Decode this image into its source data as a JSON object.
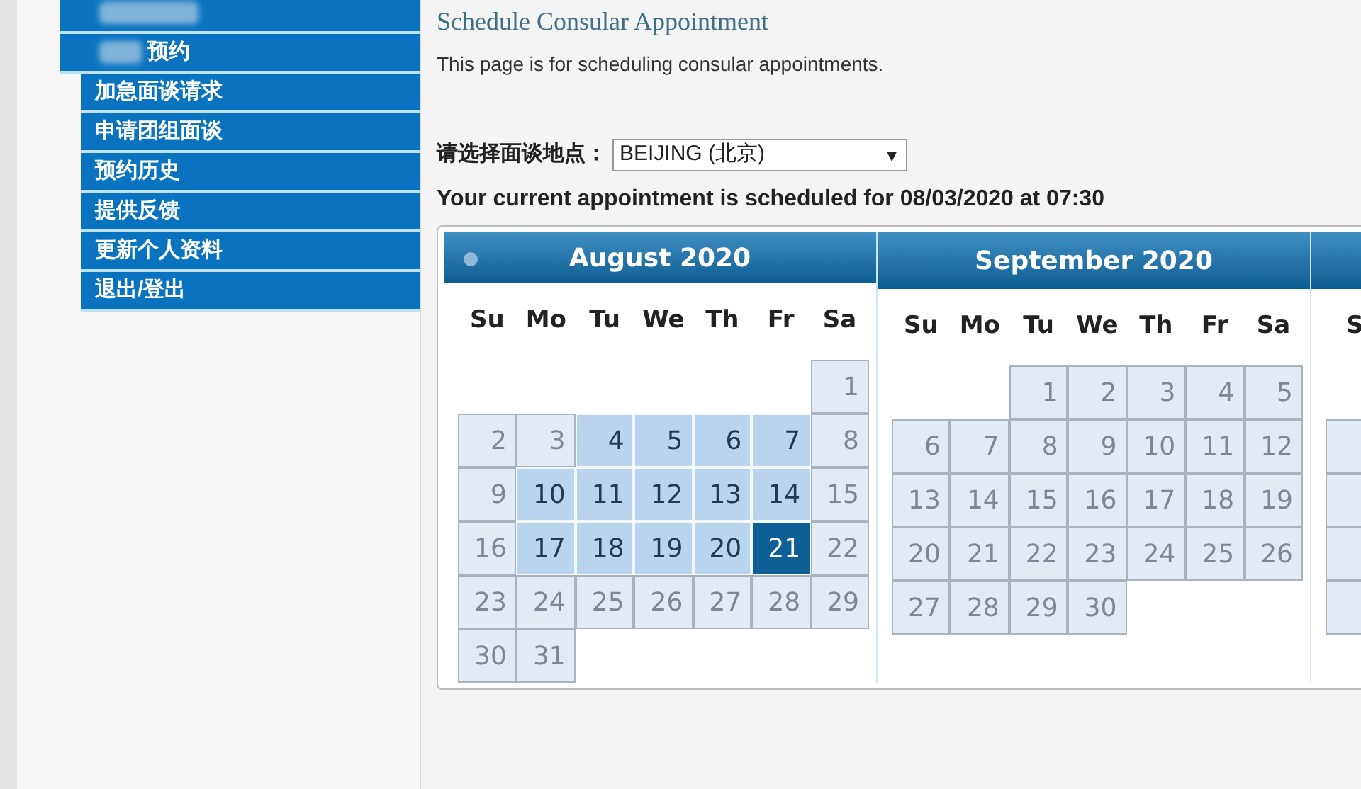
{
  "sidebar": {
    "items": [
      {
        "kind": "redacted"
      },
      {
        "kind": "partial",
        "label": "预约"
      },
      {
        "kind": "link",
        "label": "加急面谈请求"
      },
      {
        "kind": "link",
        "label": "申请团组面谈"
      },
      {
        "kind": "link",
        "label": "预约历史"
      },
      {
        "kind": "link",
        "label": "提供反馈"
      },
      {
        "kind": "link",
        "label": "更新个人资料"
      },
      {
        "kind": "link",
        "label": "退出/登出"
      }
    ]
  },
  "page": {
    "title": "Schedule Consular Appointment",
    "description": "This page is for scheduling consular appointments."
  },
  "location": {
    "label": "请选择面谈地点：",
    "value": "BEIJING (北京)",
    "caret": "▼"
  },
  "current_appointment": "Your current appointment is scheduled for 08/03/2020 at 07:30",
  "calendar": {
    "months": [
      {
        "title": "August 2020",
        "has_prev": true,
        "weekdays": [
          "Su",
          "Mo",
          "Tu",
          "We",
          "Th",
          "Fr",
          "Sa"
        ],
        "weeks": [
          [
            {
              "kind": "blank"
            },
            {
              "kind": "blank"
            },
            {
              "kind": "blank"
            },
            {
              "kind": "blank"
            },
            {
              "kind": "blank"
            },
            {
              "kind": "blank"
            },
            {
              "kind": "day",
              "label": "1",
              "available": false,
              "selected": false
            }
          ],
          [
            {
              "kind": "day",
              "label": "2",
              "available": false,
              "selected": false
            },
            {
              "kind": "day",
              "label": "3",
              "available": false,
              "selected": false
            },
            {
              "kind": "day",
              "label": "4",
              "available": true,
              "selected": false
            },
            {
              "kind": "day",
              "label": "5",
              "available": true,
              "selected": false
            },
            {
              "kind": "day",
              "label": "6",
              "available": true,
              "selected": false
            },
            {
              "kind": "day",
              "label": "7",
              "available": true,
              "selected": false
            },
            {
              "kind": "day",
              "label": "8",
              "available": false,
              "selected": false
            }
          ],
          [
            {
              "kind": "day",
              "label": "9",
              "available": false,
              "selected": false
            },
            {
              "kind": "day",
              "label": "10",
              "available": true,
              "selected": false
            },
            {
              "kind": "day",
              "label": "11",
              "available": true,
              "selected": false
            },
            {
              "kind": "day",
              "label": "12",
              "available": true,
              "selected": false
            },
            {
              "kind": "day",
              "label": "13",
              "available": true,
              "selected": false
            },
            {
              "kind": "day",
              "label": "14",
              "available": true,
              "selected": false
            },
            {
              "kind": "day",
              "label": "15",
              "available": false,
              "selected": false
            }
          ],
          [
            {
              "kind": "day",
              "label": "16",
              "available": false,
              "selected": false
            },
            {
              "kind": "day",
              "label": "17",
              "available": true,
              "selected": false
            },
            {
              "kind": "day",
              "label": "18",
              "available": true,
              "selected": false
            },
            {
              "kind": "day",
              "label": "19",
              "available": true,
              "selected": false
            },
            {
              "kind": "day",
              "label": "20",
              "available": true,
              "selected": false
            },
            {
              "kind": "day",
              "label": "21",
              "available": true,
              "selected": true
            },
            {
              "kind": "day",
              "label": "22",
              "available": false,
              "selected": false
            }
          ],
          [
            {
              "kind": "day",
              "label": "23",
              "available": false,
              "selected": false
            },
            {
              "kind": "day",
              "label": "24",
              "available": false,
              "selected": false
            },
            {
              "kind": "day",
              "label": "25",
              "available": false,
              "selected": false
            },
            {
              "kind": "day",
              "label": "26",
              "available": false,
              "selected": false
            },
            {
              "kind": "day",
              "label": "27",
              "available": false,
              "selected": false
            },
            {
              "kind": "day",
              "label": "28",
              "available": false,
              "selected": false
            },
            {
              "kind": "day",
              "label": "29",
              "available": false,
              "selected": false
            }
          ],
          [
            {
              "kind": "day",
              "label": "30",
              "available": false,
              "selected": false
            },
            {
              "kind": "day",
              "label": "31",
              "available": false,
              "selected": false
            }
          ]
        ]
      },
      {
        "title": "September 2020",
        "has_prev": false,
        "weekdays": [
          "Su",
          "Mo",
          "Tu",
          "We",
          "Th",
          "Fr",
          "Sa"
        ],
        "weeks": [
          [
            {
              "kind": "blank"
            },
            {
              "kind": "blank"
            },
            {
              "kind": "day",
              "label": "1",
              "available": false,
              "selected": false
            },
            {
              "kind": "day",
              "label": "2",
              "available": false,
              "selected": false
            },
            {
              "kind": "day",
              "label": "3",
              "available": false,
              "selected": false
            },
            {
              "kind": "day",
              "label": "4",
              "available": false,
              "selected": false
            },
            {
              "kind": "day",
              "label": "5",
              "available": false,
              "selected": false
            }
          ],
          [
            {
              "kind": "day",
              "label": "6",
              "available": false,
              "selected": false
            },
            {
              "kind": "day",
              "label": "7",
              "available": false,
              "selected": false
            },
            {
              "kind": "day",
              "label": "8",
              "available": false,
              "selected": false
            },
            {
              "kind": "day",
              "label": "9",
              "available": false,
              "selected": false
            },
            {
              "kind": "day",
              "label": "10",
              "available": false,
              "selected": false
            },
            {
              "kind": "day",
              "label": "11",
              "available": false,
              "selected": false
            },
            {
              "kind": "day",
              "label": "12",
              "available": false,
              "selected": false
            }
          ],
          [
            {
              "kind": "day",
              "label": "13",
              "available": false,
              "selected": false
            },
            {
              "kind": "day",
              "label": "14",
              "available": false,
              "selected": false
            },
            {
              "kind": "day",
              "label": "15",
              "available": false,
              "selected": false
            },
            {
              "kind": "day",
              "label": "16",
              "available": false,
              "selected": false
            },
            {
              "kind": "day",
              "label": "17",
              "available": false,
              "selected": false
            },
            {
              "kind": "day",
              "label": "18",
              "available": false,
              "selected": false
            },
            {
              "kind": "day",
              "label": "19",
              "available": false,
              "selected": false
            }
          ],
          [
            {
              "kind": "day",
              "label": "20",
              "available": false,
              "selected": false
            },
            {
              "kind": "day",
              "label": "21",
              "available": false,
              "selected": false
            },
            {
              "kind": "day",
              "label": "22",
              "available": false,
              "selected": false
            },
            {
              "kind": "day",
              "label": "23",
              "available": false,
              "selected": false
            },
            {
              "kind": "day",
              "label": "24",
              "available": false,
              "selected": false
            },
            {
              "kind": "day",
              "label": "25",
              "available": false,
              "selected": false
            },
            {
              "kind": "day",
              "label": "26",
              "available": false,
              "selected": false
            }
          ],
          [
            {
              "kind": "day",
              "label": "27",
              "available": false,
              "selected": false
            },
            {
              "kind": "day",
              "label": "28",
              "available": false,
              "selected": false
            },
            {
              "kind": "day",
              "label": "29",
              "available": false,
              "selected": false
            },
            {
              "kind": "day",
              "label": "30",
              "available": false,
              "selected": false
            }
          ]
        ]
      },
      {
        "has_prev": false,
        "weekdays": [
          "S"
        ],
        "weeks": [
          [
            {
              "kind": "blank"
            }
          ],
          [
            {
              "kind": "day",
              "available": false,
              "selected": false
            }
          ],
          [
            {
              "kind": "day",
              "available": false,
              "selected": false
            }
          ],
          [
            {
              "kind": "day",
              "available": false,
              "selected": false
            }
          ],
          [
            {
              "kind": "day",
              "available": false,
              "selected": false
            }
          ]
        ]
      }
    ]
  }
}
